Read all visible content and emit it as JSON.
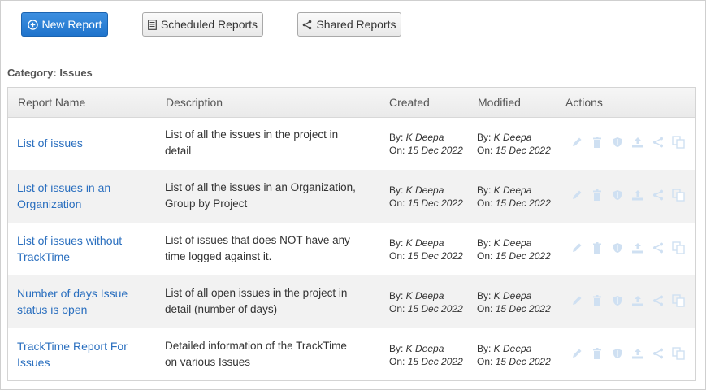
{
  "toolbar": {
    "new_report": "New Report",
    "scheduled_reports": "Scheduled Reports",
    "shared_reports": "Shared Reports"
  },
  "category": {
    "label": "Category:",
    "value": "Issues"
  },
  "table": {
    "headers": {
      "name": "Report Name",
      "description": "Description",
      "created": "Created",
      "modified": "Modified",
      "actions": "Actions"
    },
    "rows": [
      {
        "name_lines": [
          "List of issues"
        ],
        "desc_lines": [
          "List of all the issues in the project in",
          "detail"
        ],
        "created_by": "By: ",
        "created_by_name": "K Deepa",
        "created_on": "On: ",
        "created_on_date": "15 Dec 2022",
        "modified_by": "By: ",
        "modified_by_name": "K Deepa",
        "modified_on": "On: ",
        "modified_on_date": "15 Dec 2022"
      },
      {
        "name_lines": [
          "List of issues in an",
          "Organization"
        ],
        "desc_lines": [
          "List of all the issues in an Organization,",
          "Group by Project"
        ],
        "created_by": "By: ",
        "created_by_name": "K Deepa",
        "created_on": "On: ",
        "created_on_date": "15 Dec 2022",
        "modified_by": "By: ",
        "modified_by_name": "K Deepa",
        "modified_on": "On: ",
        "modified_on_date": "15 Dec 2022"
      },
      {
        "name_lines": [
          "List of issues without",
          "TrackTime"
        ],
        "desc_lines": [
          "List of issues that does NOT have any",
          "time logged against it."
        ],
        "created_by": "By: ",
        "created_by_name": "K Deepa",
        "created_on": "On: ",
        "created_on_date": "15 Dec 2022",
        "modified_by": "By: ",
        "modified_by_name": "K Deepa",
        "modified_on": "On: ",
        "modified_on_date": "15 Dec 2022"
      },
      {
        "name_lines": [
          "Number of days Issue",
          "status is open"
        ],
        "desc_lines": [
          "List of all open issues in the project in",
          "detail (number of days)"
        ],
        "created_by": "By: ",
        "created_by_name": "K Deepa",
        "created_on": "On: ",
        "created_on_date": "15 Dec 2022",
        "modified_by": "By: ",
        "modified_by_name": "K Deepa",
        "modified_on": "On: ",
        "modified_on_date": "15 Dec 2022"
      },
      {
        "name_lines": [
          "TrackTime Report For",
          "Issues"
        ],
        "desc_lines": [
          "Detailed information of the TrackTime",
          "on various Issues"
        ],
        "created_by": "By: ",
        "created_by_name": "K Deepa",
        "created_on": "On: ",
        "created_on_date": "15 Dec 2022",
        "modified_by": "By: ",
        "modified_by_name": "K Deepa",
        "modified_on": "On: ",
        "modified_on_date": "15 Dec 2022"
      }
    ],
    "action_icons": [
      "pencil-icon",
      "trash-icon",
      "shield-icon",
      "upload-icon",
      "share-icon",
      "copy-icon"
    ],
    "action_icon_color": "#cfe0f2"
  },
  "colors": {
    "primary": "#1f74cc",
    "link": "#2a6fbf",
    "row_alt": "#f2f2f2"
  }
}
